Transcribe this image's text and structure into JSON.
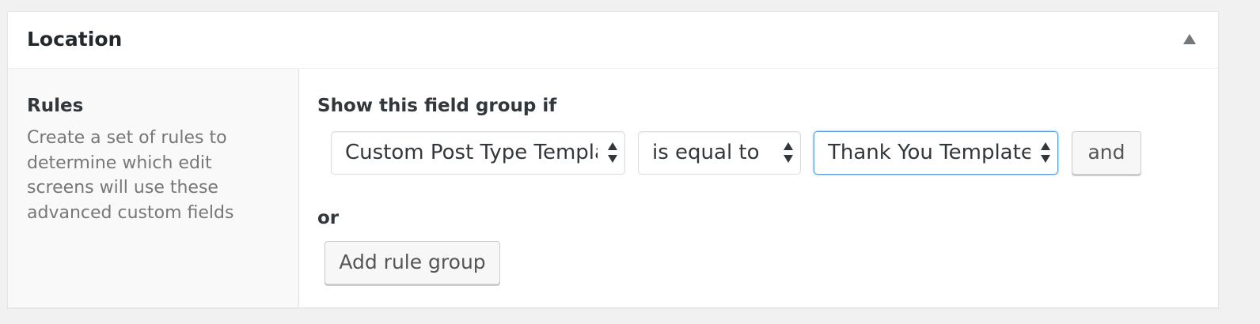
{
  "postbox": {
    "title": "Location",
    "toggle_icon": "triangle-up-icon"
  },
  "label": {
    "title": "Rules",
    "description": "Create a set of rules to determine which edit screens will use these advanced custom fields"
  },
  "rules": {
    "group_title": "Show this field group if",
    "param_value": "Custom Post Type Template",
    "operator_value": "is equal to",
    "value_value": "Thank You Template",
    "and_label": "and",
    "or_label": "or",
    "add_group_label": "Add rule group"
  },
  "colors": {
    "focus_border": "#5b9dd9",
    "background": "#f1f1f1",
    "label_column_bg": "#f9f9f9"
  }
}
